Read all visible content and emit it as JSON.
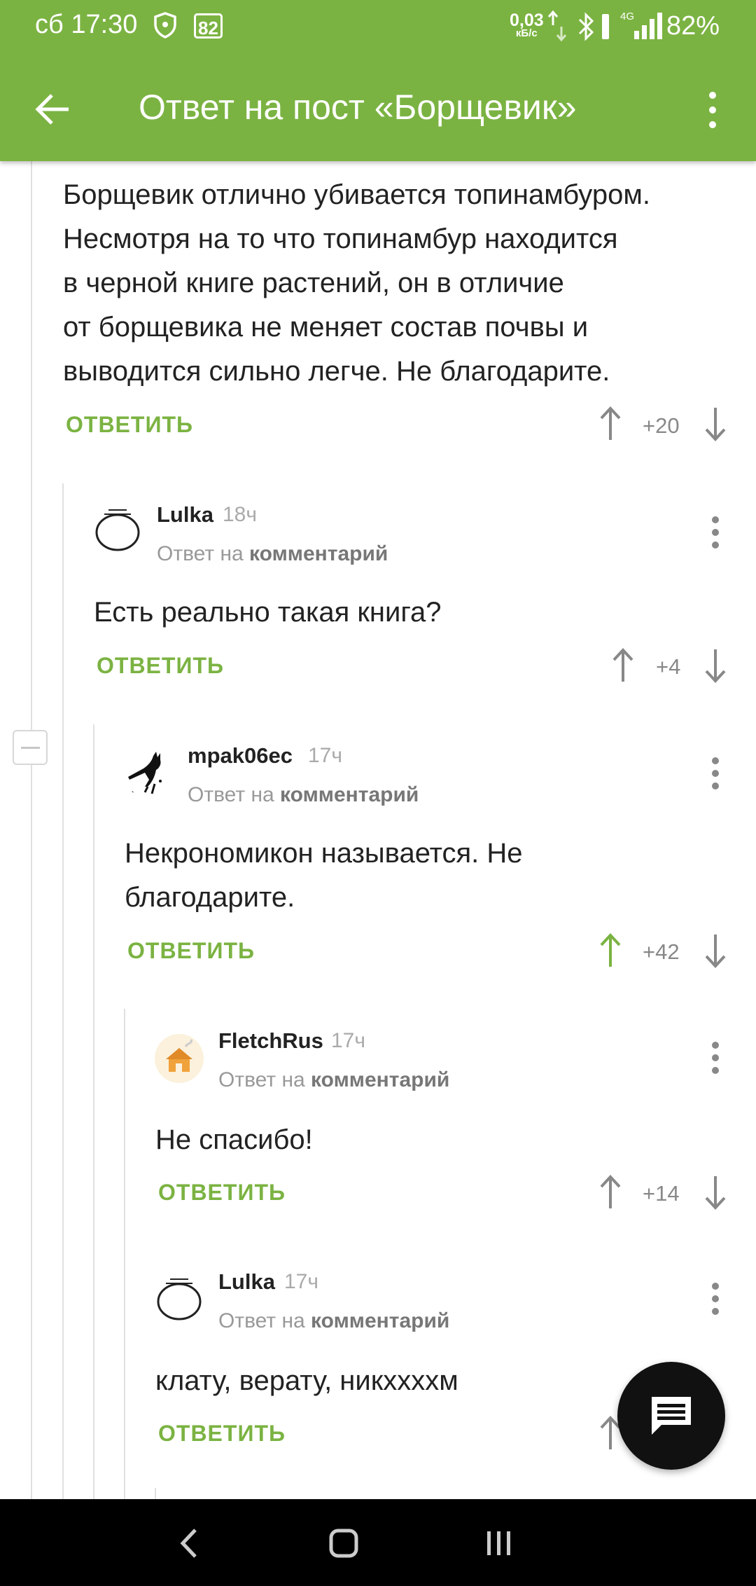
{
  "status_bar": {
    "time": "сб 17:30",
    "notification_badge": "82",
    "net_speed": "0,03",
    "net_unit": "кБ/с",
    "network": "4G",
    "battery": "82%"
  },
  "app_bar": {
    "title": "Ответ на пост «Борщевик»"
  },
  "reply_prefix": "Ответ на",
  "reply_target": "комментарий",
  "reply_label": "ОТВЕТИТЬ",
  "colors": {
    "brand": "#7bb342",
    "upvoted": "#7bb342"
  },
  "comments": [
    {
      "text_lines": [
        "Борщевик отлично убивается топинамбуром.",
        "Несмотря на то что топинамбур находится",
        "в черной книге растений, он в отличие",
        "от борщевика не меняет состав почвы и",
        "выводится сильно легче. Не благодарите."
      ],
      "score": "+20"
    },
    {
      "author": "Lulka",
      "age": "18ч",
      "avatar": "ring-icon",
      "text_lines": [
        "Есть реально такая книга?"
      ],
      "score": "+4"
    },
    {
      "author": "mpak06ec",
      "age": "17ч",
      "avatar": "cat-icon",
      "text_lines": [
        "Некрономикон называется. Не",
        "благодарите."
      ],
      "score": "+42",
      "upvoted": true
    },
    {
      "author": "FletchRus",
      "age": "17ч",
      "avatar": "house-icon",
      "text_lines": [
        "Не спасибо!"
      ],
      "score": "+14"
    },
    {
      "author": "Lulka",
      "age": "17ч",
      "avatar": "ring-icon",
      "text_lines": [
        "клату, верату, никххххм"
      ],
      "score": ""
    }
  ]
}
